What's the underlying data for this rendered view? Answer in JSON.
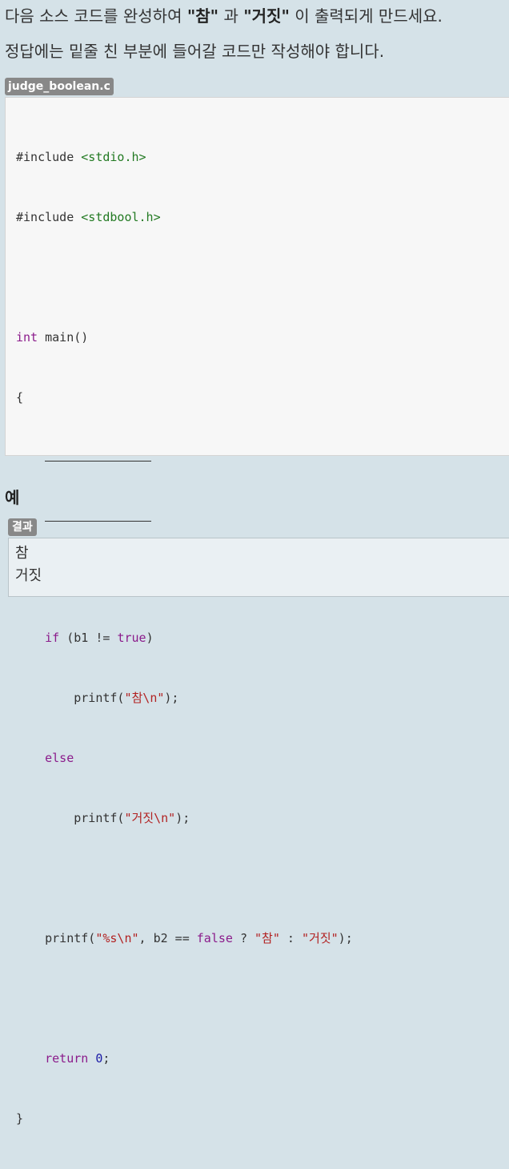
{
  "instructions": {
    "line1": {
      "p1": "다음 소스 코드를 완성하여 ",
      "em1": "\"참\"",
      "p2": " 과 ",
      "em2": "\"거짓\"",
      "p3": " 이 출력되게 만드세요."
    },
    "line2": "정답에는 밑줄 친 부분에 들어갈 코드만 작성해야 합니다."
  },
  "code_block": {
    "filename": "judge_boolean.c",
    "blank_placeholder": "______________",
    "tokens": {
      "include_directive": "#include",
      "header_stdio": "<stdio.h>",
      "header_stdbool": "<stdbool.h>",
      "kw_int": "int",
      "main_signature": " main()",
      "open_brace": "{",
      "close_brace": "}",
      "kw_if": "if",
      "if_condition_open": " (b1 != ",
      "kw_true": "true",
      "paren_close": ")",
      "kw_else": "else",
      "printf_open": "printf(",
      "printf_close": ");",
      "str_true_nl": "\"참\\n\"",
      "str_false_nl": "\"거짓\\n\"",
      "str_format": "\"%s\\n\"",
      "ternary_middle": ", b2 == ",
      "kw_false": "false",
      "ternary_q": " ? ",
      "ternary_colon": " : ",
      "str_true": "\"참\"",
      "str_false": "\"거짓\"",
      "kw_return": "return",
      "num_zero": "0",
      "semicolon": ";"
    }
  },
  "example": {
    "heading": "예",
    "result_label": "결과",
    "output_lines": [
      "참",
      "거짓"
    ]
  }
}
